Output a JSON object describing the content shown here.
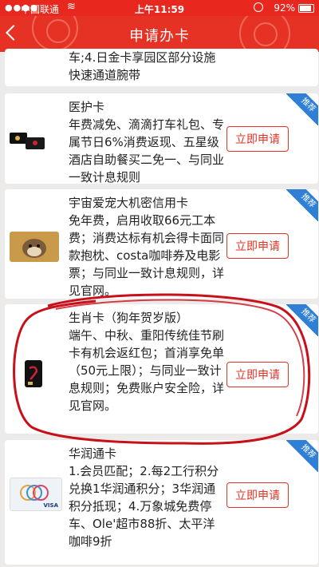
{
  "status_bar": {
    "carrier": "中国联通",
    "time": "上午11:59",
    "battery_pct": "92%"
  },
  "nav": {
    "title": "申请办卡",
    "back_icon": "chevron-left-icon"
  },
  "cards": [
    {
      "name": "",
      "desc": "车;4.日金卡享园区部分设施快速通道腕带",
      "has_button": false,
      "badge": ""
    },
    {
      "name": "医护卡",
      "desc": "年费减免、滴滴打车礼包、专属节日6%消费返现、五星级酒店自助餐买二免一、与同业一致计息规则",
      "button": "立即申请",
      "badge": "推荐"
    },
    {
      "name": "宇宙爱宠大机密信用卡",
      "desc": "免年费，启用收取66元工本费；消费达标有机会得卡面同款抱枕、costa咖啡券及电影票；与同业一致计息规则，详见官网。",
      "button": "立即申请",
      "badge": "推荐"
    },
    {
      "name": "生肖卡（狗年贺岁版）",
      "desc": "端午、中秋、重阳传统佳节刷卡有机会返红包；首消享免单（50元上限）；与同业一致计息规则；免费账户安全险，详见官网。",
      "button": "立即申请",
      "badge": "推荐"
    },
    {
      "name": "华润通卡",
      "desc": "1.会员匹配；2.每2工行积分兑换1华润通积分；3华润通积分抵现；4.万象城免费停车、Ole'超市88折、太平洋咖啡9折",
      "button": "立即申请",
      "badge": "推荐"
    }
  ],
  "thumb_text": {
    "visa": "VISA"
  },
  "colors": {
    "brand_red": "#e53225",
    "badge_blue": "#2f7fd6",
    "annotation_red": "#c8101a"
  }
}
